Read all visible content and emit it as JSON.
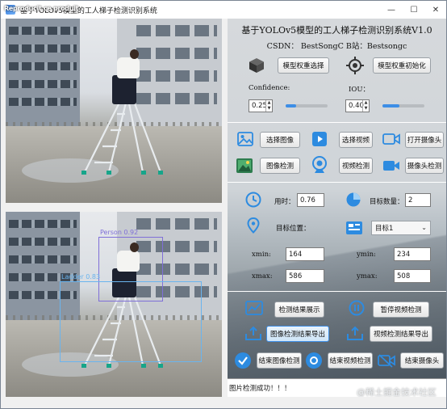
{
  "window": {
    "title": "基于YOLOv5模型的工人梯子检测识别系统",
    "watermark_overlay": "Reproducit ce produit"
  },
  "header": {
    "title": "基于YOLOv5模型的工人梯子检测识别系统V1.0",
    "subtitle": "CSDN：  BestSongC   B站：Bestsongc"
  },
  "model": {
    "select_label": "模型权重选择",
    "init_label": "模型权重初始化"
  },
  "params": {
    "confidence_label": "Confidence:",
    "confidence_value": "0.25",
    "confidence_level": 0.25,
    "iou_label": "IOU：",
    "iou_value": "0.40",
    "iou_level": 0.4
  },
  "source": {
    "select_image": "选择图像",
    "select_video": "选择视频",
    "open_camera": "打开摄像头",
    "image_detect": "图像检测",
    "video_detect": "视频检测",
    "camera_detect": "摄像头检测"
  },
  "results": {
    "time_label": "用时：",
    "time_value": "0.76",
    "count_label": "目标数量：",
    "count_value": "2",
    "position_label": "目标位置：",
    "target_select": "目标1",
    "xmin_label": "xmin:",
    "xmin_value": "164",
    "ymin_label": "ymin:",
    "ymin_value": "234",
    "xmax_label": "xmax:",
    "xmax_value": "586",
    "ymax_label": "ymax:",
    "ymax_value": "508"
  },
  "actions": {
    "show_result": "检测结果展示",
    "pause_video": "暂停视频检测",
    "export_image": "图像检测结果导出",
    "export_video": "视频检测结果导出",
    "end_image": "结束图像检测",
    "end_video": "结束视频检测",
    "end_camera": "结束摄像头"
  },
  "detections": [
    {
      "label": "Person",
      "score": "0.92",
      "text": "Person  0.92"
    },
    {
      "label": "Ladder",
      "score": "0.83",
      "text": "Ladder  0.83"
    }
  ],
  "status": {
    "message": "图片检测成功！！！"
  },
  "footer": {
    "watermark": "@稀土掘金技术社区"
  },
  "colors": {
    "person_box": "#7f6fd8",
    "ladder_box": "#6ab4ee",
    "accent": "#3d8ee6"
  }
}
